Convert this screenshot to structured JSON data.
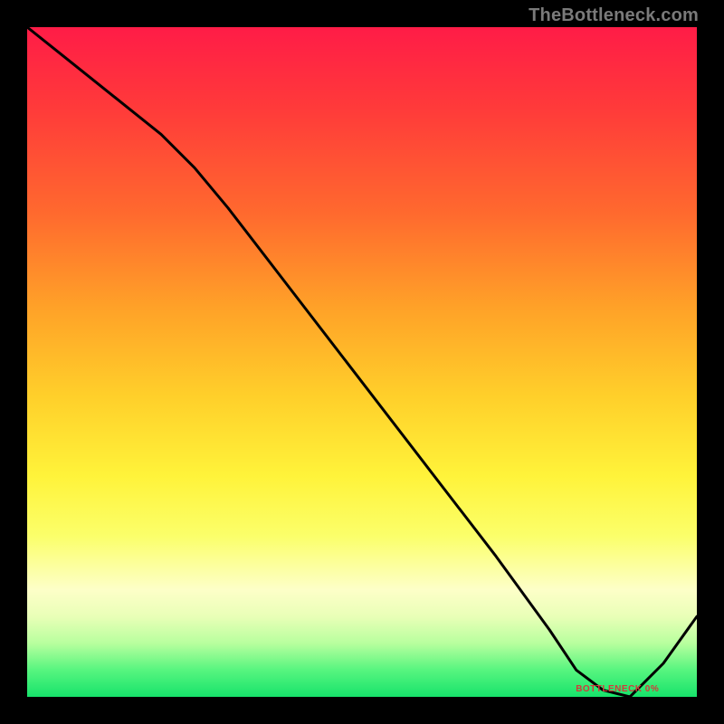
{
  "watermark": "TheBottleneck.com",
  "bottom_label": "BOTTLENECK 0%",
  "colors": {
    "frame": "#000000",
    "curve": "#000000",
    "label": "#d23a3a",
    "watermark": "#7a7a7a"
  },
  "chart_data": {
    "type": "line",
    "title": "",
    "xlabel": "",
    "ylabel": "",
    "xlim": [
      0,
      100
    ],
    "ylim": [
      0,
      100
    ],
    "x": [
      0,
      5,
      10,
      15,
      20,
      25,
      30,
      40,
      50,
      60,
      70,
      78,
      82,
      86,
      90,
      95,
      100
    ],
    "y": [
      100,
      96,
      92,
      88,
      84,
      79,
      73,
      60,
      47,
      34,
      21,
      10,
      4,
      1,
      0,
      5,
      12
    ],
    "optimum_x": 88,
    "background_gradient": [
      {
        "stop": 0.0,
        "hex": "#ff1c47"
      },
      {
        "stop": 0.12,
        "hex": "#ff3a3a"
      },
      {
        "stop": 0.28,
        "hex": "#ff6a2e"
      },
      {
        "stop": 0.42,
        "hex": "#ffa228"
      },
      {
        "stop": 0.55,
        "hex": "#ffcf2a"
      },
      {
        "stop": 0.67,
        "hex": "#fff33a"
      },
      {
        "stop": 0.76,
        "hex": "#fbff6a"
      },
      {
        "stop": 0.84,
        "hex": "#fdffc8"
      },
      {
        "stop": 0.88,
        "hex": "#e9ffb7"
      },
      {
        "stop": 0.92,
        "hex": "#b8ff9e"
      },
      {
        "stop": 0.96,
        "hex": "#57f57f"
      },
      {
        "stop": 1.0,
        "hex": "#17e36b"
      }
    ]
  }
}
